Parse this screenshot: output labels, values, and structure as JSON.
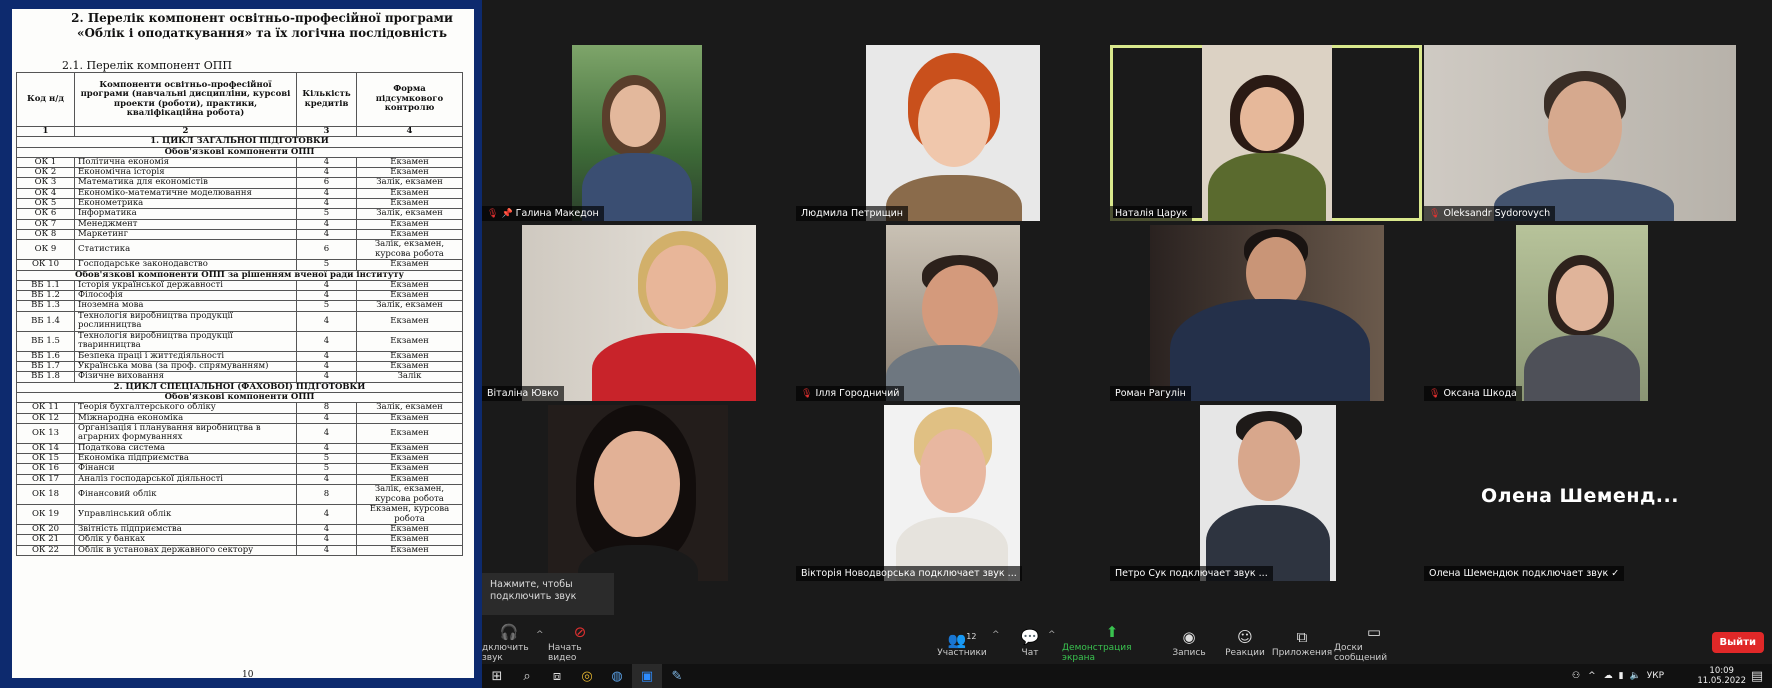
{
  "doc": {
    "title": "2. Перелік компонент освітньо-професійної програми «Облік і оподаткування» та їх логічна послідовність",
    "subtitle": "2.1. Перелік компонент ОПП",
    "headers": [
      "Код н/д",
      "Компоненти освітньо-професійної програми (навчальні дисципліни, курсові проекти (роботи), практики, кваліфікаційна робота)",
      "Кількість кредитів",
      "Форма підсумкового контролю"
    ],
    "numrow": [
      "1",
      "2",
      "3",
      "4"
    ],
    "rows": [
      {
        "type": "sec",
        "text": "1. ЦИКЛ ЗАГАЛЬНОЇ ПІДГОТОВКИ"
      },
      {
        "type": "sec",
        "text": "Обов'язкові компоненти ОПП"
      },
      {
        "type": "row",
        "code": "ОК 1",
        "name": "Політична економія",
        "cr": "4",
        "form": "Екзамен"
      },
      {
        "type": "row",
        "code": "ОК 2",
        "name": "Економічна історія",
        "cr": "4",
        "form": "Екзамен"
      },
      {
        "type": "row",
        "code": "ОК 3",
        "name": "Математика для економістів",
        "cr": "6",
        "form": "Залік, екзамен"
      },
      {
        "type": "row",
        "code": "ОК 4",
        "name": "Економіко-математичне моделювання",
        "cr": "4",
        "form": "Екзамен"
      },
      {
        "type": "row",
        "code": "ОК 5",
        "name": "Економетрика",
        "cr": "4",
        "form": "Екзамен"
      },
      {
        "type": "row",
        "code": "ОК 6",
        "name": "Інформатика",
        "cr": "5",
        "form": "Залік, екзамен"
      },
      {
        "type": "row",
        "code": "ОК 7",
        "name": "Менеджмент",
        "cr": "4",
        "form": "Екзамен"
      },
      {
        "type": "row",
        "code": "ОК 8",
        "name": "Маркетинг",
        "cr": "4",
        "form": "Екзамен"
      },
      {
        "type": "row2",
        "code": "ОК 9",
        "name": "Статистика",
        "cr": "6",
        "form": "Залік, екзамен, курсова робота"
      },
      {
        "type": "row",
        "code": "ОК 10",
        "name": "Господарське законодавство",
        "cr": "5",
        "form": "Екзамен"
      },
      {
        "type": "sec",
        "text": "Обов'язкові компоненти ОПП за рішенням вченої ради інституту"
      },
      {
        "type": "row",
        "code": "ВБ 1.1",
        "name": "Історія української державності",
        "cr": "4",
        "form": "Екзамен"
      },
      {
        "type": "row",
        "code": "ВБ 1.2",
        "name": "Філософія",
        "cr": "4",
        "form": "Екзамен"
      },
      {
        "type": "row",
        "code": "ВБ 1.3",
        "name": "Іноземна мова",
        "cr": "5",
        "form": "Залік, екзамен"
      },
      {
        "type": "row2",
        "code": "ВБ 1.4",
        "name": "Технологія виробництва продукції рослинництва",
        "cr": "4",
        "form": "Екзамен"
      },
      {
        "type": "row2",
        "code": "ВБ 1.5",
        "name": "Технологія виробництва продукції тваринництва",
        "cr": "4",
        "form": "Екзамен"
      },
      {
        "type": "row",
        "code": "ВБ 1.6",
        "name": "Безпека праці і життєдіяльності",
        "cr": "4",
        "form": "Екзамен"
      },
      {
        "type": "row",
        "code": "ВБ 1.7",
        "name": "Українська мова (за проф. спрямуванням)",
        "cr": "4",
        "form": "Екзамен"
      },
      {
        "type": "row",
        "code": "ВБ 1.8",
        "name": "Фізичне виховання",
        "cr": "4",
        "form": "Залік"
      },
      {
        "type": "sec",
        "text": "2. ЦИКЛ СПЕЦІАЛЬНОЇ (ФАХОВОЇ) ПІДГОТОВКИ"
      },
      {
        "type": "sec",
        "text": "Обов'язкові компоненти ОПП"
      },
      {
        "type": "row",
        "code": "ОК 11",
        "name": "Теорія бухгалтерського обліку",
        "cr": "8",
        "form": "Залік, екзамен"
      },
      {
        "type": "row",
        "code": "ОК 12",
        "name": "Міжнародна економіка",
        "cr": "4",
        "form": "Екзамен"
      },
      {
        "type": "row2",
        "code": "ОК 13",
        "name": "Організація і планування виробництва в аграрних формуваннях",
        "cr": "4",
        "form": "Екзамен"
      },
      {
        "type": "row",
        "code": "ОК 14",
        "name": "Податкова система",
        "cr": "4",
        "form": "Екзамен"
      },
      {
        "type": "row",
        "code": "ОК 15",
        "name": "Економіка підприємства",
        "cr": "5",
        "form": "Екзамен"
      },
      {
        "type": "row",
        "code": "ОК 16",
        "name": "Фінанси",
        "cr": "5",
        "form": "Екзамен"
      },
      {
        "type": "row",
        "code": "ОК 17",
        "name": "Аналіз господарської діяльності",
        "cr": "4",
        "form": "Екзамен"
      },
      {
        "type": "row2",
        "code": "ОК 18",
        "name": "Фінансовий облік",
        "cr": "8",
        "form": "Залік, екзамен, курсова робота"
      },
      {
        "type": "row2",
        "code": "ОК 19",
        "name": "Управлінський облік",
        "cr": "4",
        "form": "Екзамен, курсова робота"
      },
      {
        "type": "row",
        "code": "ОК 20",
        "name": "Звітність підприємства",
        "cr": "4",
        "form": "Екзамен"
      },
      {
        "type": "row",
        "code": "ОК 21",
        "name": "Облік у банках",
        "cr": "4",
        "form": "Екзамен"
      },
      {
        "type": "row",
        "code": "ОК 22",
        "name": "Облік в установах державного сектору",
        "cr": "4",
        "form": "Екзамен"
      }
    ],
    "page_num": "10"
  },
  "participants": [
    {
      "name": "Галина Македон",
      "muted": true,
      "pinned": true
    },
    {
      "name": "Людмила Петрищин",
      "muted": false
    },
    {
      "name": "Наталія Царук",
      "muted": false,
      "active": true
    },
    {
      "name": "Oleksandr Sydorovych",
      "muted": true
    },
    {
      "name": "Віталіна Ювко",
      "muted": false
    },
    {
      "name": "Ілля Городничий",
      "muted": true
    },
    {
      "name": "Роман Рагулін",
      "muted": false
    },
    {
      "name": "Оксана Шкода",
      "muted": true
    },
    {
      "name": "",
      "muted": false
    },
    {
      "name": "Вікторія Новодворська подключает звук ...",
      "muted": false
    },
    {
      "name": "Петро Сук подключает звук ...",
      "muted": false
    },
    {
      "name": "Олена Шемендюк подключает звук ✓",
      "muted": false
    }
  ],
  "big_name": "Олена  Шеменд...",
  "tooltip": "Нажмите, чтобы подключить звук",
  "toolbar": {
    "audio": "дключить звук",
    "video": "Начать видео",
    "participants": "Участники",
    "participants_count": "12",
    "chat": "Чат",
    "share": "Демонстрация экрана",
    "record": "Запись",
    "reactions": "Реакции",
    "apps": "Приложения",
    "whiteboards": "Доски сообщений",
    "leave": "Выйти"
  },
  "taskbar": {
    "lang": "УКР",
    "time": "10:09",
    "date": "11.05.2022"
  },
  "colors": {
    "active_border": "#d9e88c",
    "leave": "#e02828",
    "share": "#39c24f",
    "doc_frame": "#0d2a6e"
  }
}
